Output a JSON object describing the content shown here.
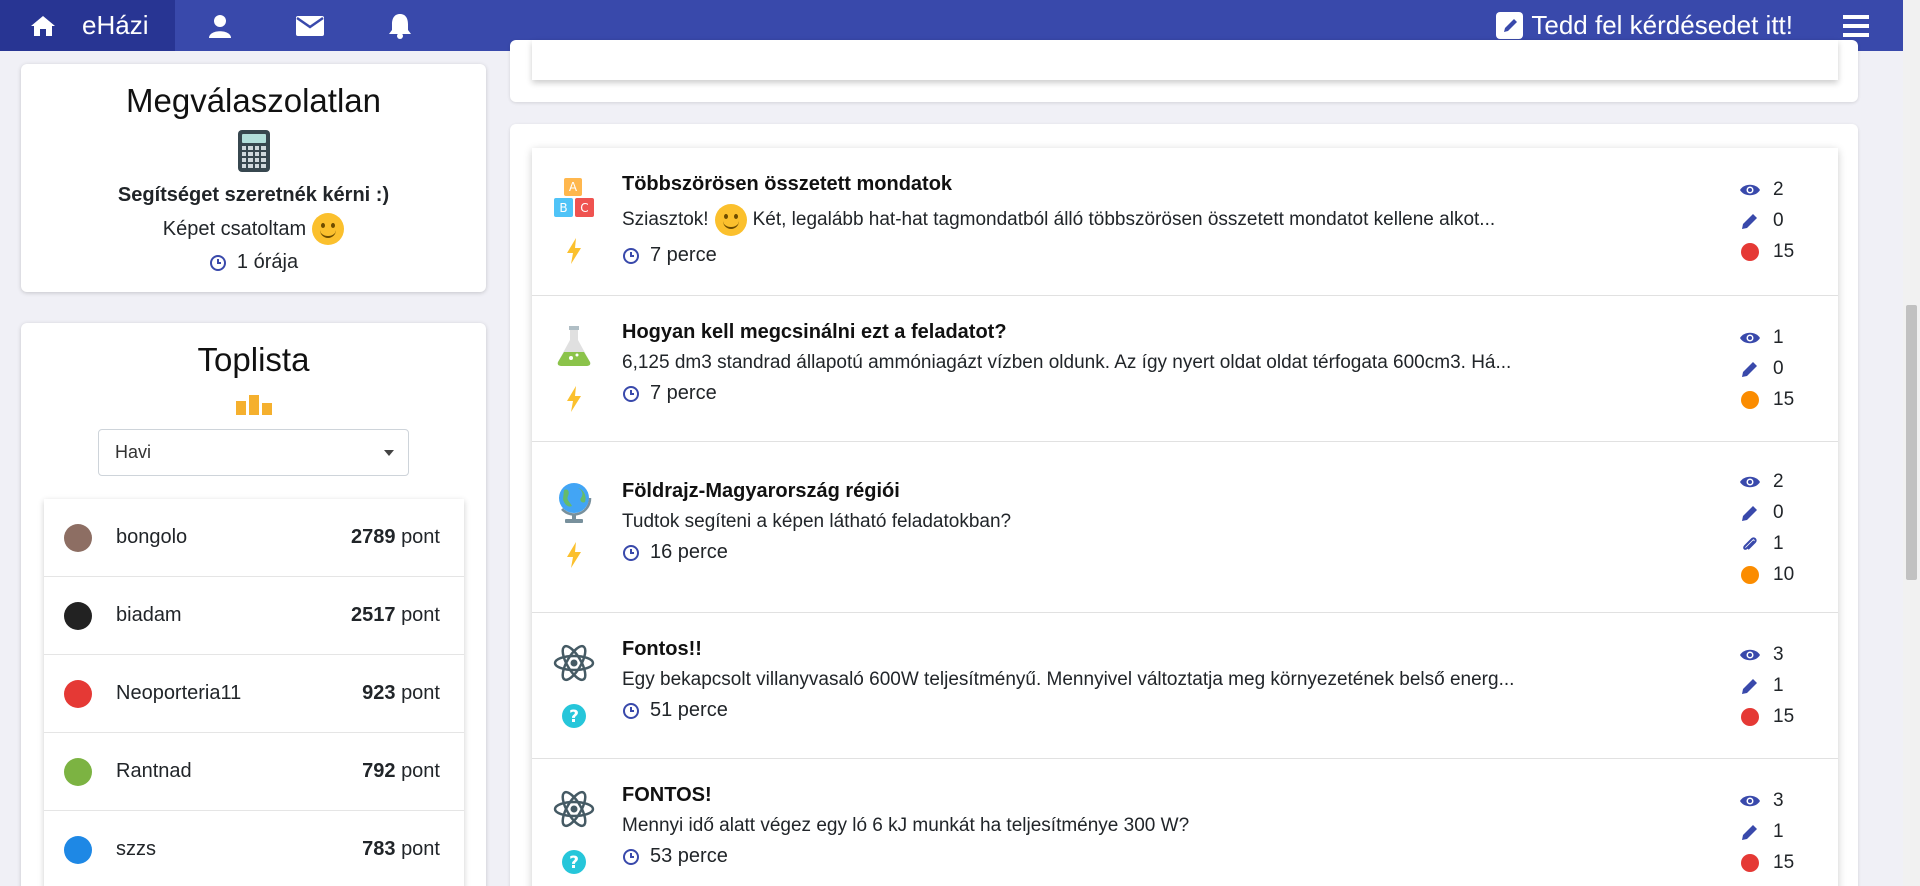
{
  "navbar": {
    "brand": "eHázi",
    "ask_label": "Tedd fel kérdésedet itt!"
  },
  "unanswered": {
    "heading": "Megválaszolatlan",
    "title": "Segítséget szeretnék kérni :)",
    "body": "Képet csatoltam",
    "time": "1 órája"
  },
  "toplist": {
    "heading": "Toplista",
    "period_selected": "Havi",
    "pont_label": "pont",
    "users": [
      {
        "name": "bongolo",
        "points": "2789",
        "avatar_color": "#8d6e63"
      },
      {
        "name": "biadam",
        "points": "2517",
        "avatar_color": "#222222"
      },
      {
        "name": "Neoporteria11",
        "points": "923",
        "avatar_color": "#e53935"
      },
      {
        "name": "Rantnad",
        "points": "792",
        "avatar_color": "#7cb342"
      },
      {
        "name": "szzs",
        "points": "783",
        "avatar_color": "#1e88e5"
      }
    ]
  },
  "questions": [
    {
      "title": "Többszörösen összetett mondatok",
      "text_before": "Sziasztok!",
      "text": "Két, legalább hat-hat tagmondatból álló többszörösen összetett mondatot kellene alkot...",
      "time": "7 perce",
      "subject_icon": "abc-blocks-icon",
      "status_icon": "lightning-icon",
      "views": "2",
      "answers": "0",
      "attachments": "",
      "points": "15",
      "point_color": "#e53935"
    },
    {
      "title": "Hogyan kell megcsinálni ezt a feladatot?",
      "text_before": "",
      "text": "6,125 dm3 standrad állapotú ammóniagázt vízben oldunk. Az így nyert oldat oldat térfogata 600cm3. Há...",
      "time": "7 perce",
      "subject_icon": "flask-icon",
      "status_icon": "lightning-icon",
      "views": "1",
      "answers": "0",
      "attachments": "",
      "points": "15",
      "point_color": "#fb8c00"
    },
    {
      "title": "Földrajz-Magyarország régiói",
      "text_before": "",
      "text": "Tudtok segíteni a képen látható feladatokban?",
      "time": "16 perce",
      "subject_icon": "globe-icon",
      "status_icon": "lightning-icon",
      "views": "2",
      "answers": "0",
      "attachments": "1",
      "points": "10",
      "point_color": "#fb8c00"
    },
    {
      "title": "Fontos!!",
      "text_before": "",
      "text": "Egy bekapcsolt villanyvasaló 600W teljesítményű. Mennyivel változtatja meg környezetének belső energ...",
      "time": "51 perce",
      "subject_icon": "atom-icon",
      "status_icon": "question-icon",
      "views": "3",
      "answers": "1",
      "attachments": "",
      "points": "15",
      "point_color": "#e53935"
    },
    {
      "title": "FONTOS!",
      "text_before": "",
      "text": "Mennyi idő alatt végez egy ló 6 kJ munkát ha teljesítménye 300 W?",
      "time": "53 perce",
      "subject_icon": "atom-icon",
      "status_icon": "question-icon",
      "views": "3",
      "answers": "1",
      "attachments": "",
      "points": "15",
      "point_color": "#e53935"
    }
  ]
}
